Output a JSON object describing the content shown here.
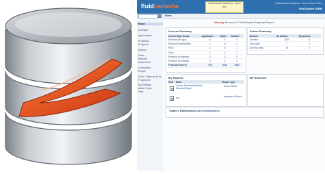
{
  "app": {
    "brand_prefix": "fluid",
    "brand_accent": "cadashe"
  },
  "toast": {
    "lines": [
      "FluidCadashe Academico - Demo",
      "Allo"
    ]
  },
  "header": {
    "user_info": "FluidCadashe Academico - Demo Version 2.00.0",
    "user_name": "FluidCadashe ADMIN"
  },
  "tabbar": {
    "home_label": "Home"
  },
  "sidebar": {
    "search_go": "Go",
    "items": [
      {
        "label": "Home",
        "active": true
      },
      {
        "label": "Licenses"
      },
      {
        "label": "Agreements"
      },
      {
        "label": "Proyectos"
      },
      {
        "label": "Programs"
      },
      {
        "label": "Actions"
      },
      {
        "label": "Maps"
      },
      {
        "label": "Reports"
      },
      {
        "label": "Documents"
      },
      {
        "label": "Companies"
      },
      {
        "label": "People"
      },
      {
        "label": "Chile, Chilenos de la"
      },
      {
        "label": "Proyección"
      },
      {
        "label": "My Settings"
      },
      {
        "label": "Admin Tools"
      },
      {
        "label": "Help"
      }
    ]
  },
  "breadcrumb": {
    "warning": "Warning",
    "text": " See errors in FluidCadashe Diagnostic Report"
  },
  "license_summary": {
    "title": "License Summary",
    "columns": [
      "License Type Group",
      "Application",
      "Active",
      "Inactive"
    ],
    "rows": [
      [
        "Derechos de Agua",
        "0",
        "0",
        "0"
      ],
      [
        "Derechos Superficiales",
        "1",
        "11",
        "0"
      ],
      [
        "MISC",
        "2",
        "8",
        "1"
      ],
      [
        "Otros",
        "0",
        "0",
        "0"
      ],
      [
        "Permisos de Barreras",
        "0",
        "0",
        "0"
      ],
      [
        "Permisos de Energia",
        "0",
        "0",
        "0"
      ],
      [
        "Propiedad Minera",
        "278",
        "3112",
        "2403"
      ]
    ]
  },
  "action_summary": {
    "title": "Action Summary",
    "columns": [
      "Actions",
      "All Actions",
      "My Actions"
    ],
    "rows": [
      [
        "Overdue",
        "4620",
        "0"
      ],
      [
        "Due today",
        "1",
        "0"
      ],
      [
        "Due this week",
        "18",
        "0"
      ]
    ]
  },
  "my_reports": {
    "title": "My Reports",
    "columns": [
      "View",
      "Name",
      "Report Type"
    ],
    "rows": [
      {
        "name": "License Renewals Maintain Standard Report",
        "type": "Action Search"
      },
      {
        "name": "test",
        "type": "Agreement Search"
      }
    ]
  },
  "my_searches": {
    "title": "My Searches"
  },
  "notifications": {
    "label": "Today's Notifications",
    "link": "(All Notifications)"
  },
  "colors": {
    "topbar": "#2f6fae",
    "accent": "#f47a3a",
    "db_orange": "#e94e1b",
    "db_silver": "#b9bec4"
  }
}
